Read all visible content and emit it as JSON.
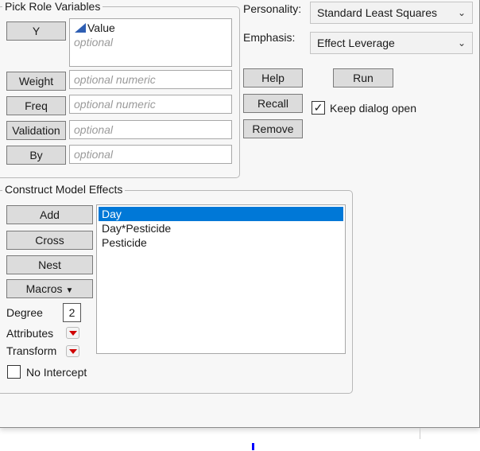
{
  "pick_roles": {
    "title": "Pick Role Variables",
    "roles": [
      {
        "button": "Y",
        "value": "Value",
        "placeholder": "optional"
      },
      {
        "button": "Weight",
        "placeholder": "optional numeric"
      },
      {
        "button": "Freq",
        "placeholder": "optional numeric"
      },
      {
        "button": "Validation",
        "placeholder": "optional"
      },
      {
        "button": "By",
        "placeholder": "optional"
      }
    ]
  },
  "personality": {
    "label": "Personality:",
    "value": "Standard Least Squares"
  },
  "emphasis": {
    "label": "Emphasis:",
    "value": "Effect Leverage"
  },
  "actions": {
    "help": "Help",
    "run": "Run",
    "recall": "Recall",
    "remove": "Remove",
    "keep_open": "Keep dialog open",
    "keep_open_checked": true
  },
  "effects": {
    "title": "Construct Model Effects",
    "add": "Add",
    "cross": "Cross",
    "nest": "Nest",
    "macros": "Macros",
    "degree_label": "Degree",
    "degree": "2",
    "attributes": "Attributes",
    "transform": "Transform",
    "no_intercept": "No Intercept",
    "items": [
      "Day",
      "Day*Pesticide",
      "Pesticide"
    ],
    "selected": "Day"
  },
  "colors": {
    "selection": "#0078d7",
    "continuous_icon": "#2f5fb3",
    "red_triangle": "#d00000"
  }
}
